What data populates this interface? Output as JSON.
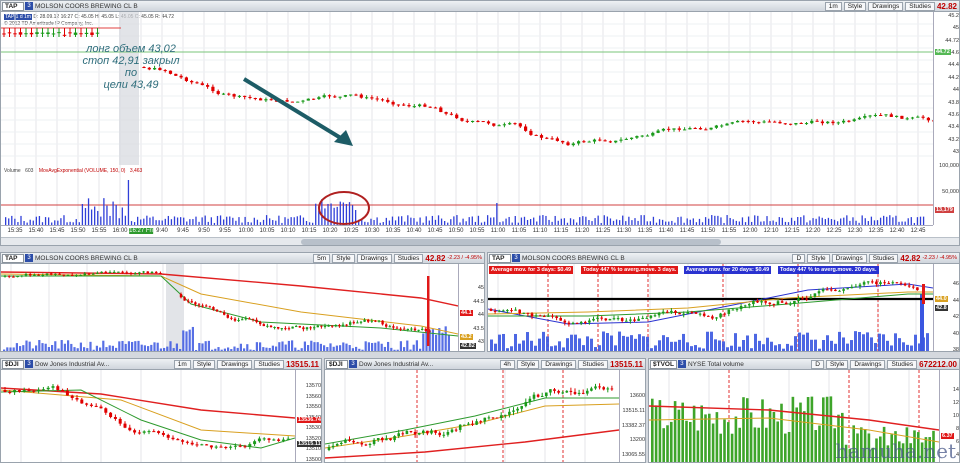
{
  "main": {
    "symbol": "TAP",
    "title": "MOLSON COORS BREWING CL B",
    "tabs": [
      "1m",
      "Style",
      "Drawings",
      "Studies"
    ],
    "price": "42.82",
    "info_label": "TAP 1 d 1m",
    "info_text": "D: 28.09.12 16:27  O: 45.05  H: 45.05  L: 45.05  C: 45.05  R: 44.72",
    "copyright": "© 2012 TD Ameritrade IP Company, Inc.",
    "yticks": [
      "45.2",
      "45",
      "44.72",
      "44.6",
      "44.4",
      "44.2",
      "44",
      "43.8",
      "43.6",
      "43.4",
      "43.2",
      "43"
    ],
    "price_label": "44.72",
    "annotation": "лонг объем 43,02\nстоп 42,91 закрыл по\nцели 43,49",
    "volume_label": "Volume",
    "volume_value": "603",
    "mov_avg_label": "MovAvgExponential (VOLUME, 150, 0)",
    "mov_avg_value": "3,463",
    "vol_ticks": [
      "100,000",
      "50,000",
      "13,179"
    ],
    "xticks": [
      "15:35",
      "15:40",
      "15:45",
      "15:50",
      "15:55",
      "16:00",
      "16:27 Fri",
      "9:40",
      "9:45",
      "9:50",
      "9:55",
      "10:00",
      "10:05",
      "10:10",
      "10:15",
      "10:20",
      "10:25",
      "10:30",
      "10:35",
      "10:40",
      "10:45",
      "10:50",
      "10:55",
      "11:00",
      "11:05",
      "11:10",
      "11:15",
      "11:20",
      "11:25",
      "11:30",
      "11:35",
      "11:40",
      "11:45",
      "11:50",
      "11:55",
      "12:00",
      "12:10",
      "12:15",
      "12:20",
      "12:25",
      "12:30",
      "12:35",
      "12:40",
      "12:45"
    ]
  },
  "mid_left": {
    "symbol": "TAP",
    "title": "MOLSON COORS BREWING CL B",
    "tabs": [
      "5m",
      "Style",
      "Drawings",
      "Studies"
    ],
    "price": "42.82",
    "chg": "-2.23 / -4.95%",
    "yticks": [
      "45",
      "44.5",
      "44",
      "43.5",
      "43",
      "42.5"
    ],
    "labels": [
      "44.1",
      "43.2",
      "42.82"
    ]
  },
  "mid_right": {
    "symbol": "TAP",
    "title": "MOLSON COORS BREWING CL B",
    "tabs": [
      "D",
      "Style",
      "Drawings",
      "Studies"
    ],
    "price": "42.82",
    "chg": "-2.23 / -4.95%",
    "stats": [
      "Average mov. for 3 days: $0.49",
      "Today 447 % to averg.move. 3 days.",
      "Average mov. for 20 days: $0.49",
      "Today 447 % to averg.move. 20 days."
    ],
    "yticks": [
      "46",
      "44",
      "42",
      "40",
      "38"
    ],
    "labels": [
      "44.0",
      "42.8"
    ]
  },
  "bot1": {
    "symbol": "$DJI",
    "title": "Dow Jones Industrial Av...",
    "tabs": [
      "1m",
      "Style",
      "Drawings",
      "Studies"
    ],
    "price": "13515.11",
    "yticks": [
      "13570",
      "13560",
      "13550",
      "13540",
      "13530",
      "13520",
      "13510",
      "13500",
      "13490"
    ],
    "labels": [
      "13536.74",
      "13515.11"
    ]
  },
  "bot2": {
    "symbol": "$DJI",
    "title": "Dow Jones Industrial Av...",
    "tabs": [
      "4h",
      "Style",
      "Drawings",
      "Studies"
    ],
    "price": "13515.11",
    "yticks": [
      "13600",
      "13515.11",
      "13382.37",
      "13200",
      "13065.55",
      "12800"
    ],
    "labels": [
      "13515.11",
      "13382.37",
      "13065.55"
    ]
  },
  "bot3": {
    "symbol": "$TVOL",
    "title": "NYSE Total volume",
    "tabs": [
      "D",
      "Style",
      "Drawings",
      "Studies"
    ],
    "price": "672212.00",
    "yticks": [
      "14",
      "12",
      "10",
      "8",
      "6",
      "4",
      "2"
    ],
    "labels": [
      "6.37"
    ]
  },
  "watermark": "hamuha.net",
  "colors": {
    "down": "#e00000",
    "up": "#1a9a1a",
    "vol": "#2f3fd8",
    "arrow": "#1d5c66"
  }
}
